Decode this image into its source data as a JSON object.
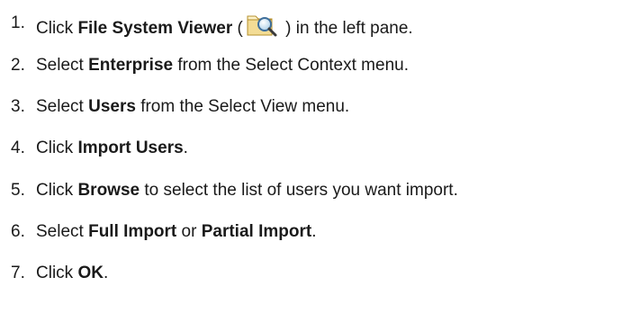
{
  "steps": [
    {
      "num": "1.",
      "pre": "Click ",
      "bold1": "File System Viewer",
      "mid": " (",
      "icon": "folder-magnifier-icon",
      "post": " ) in the left pane."
    },
    {
      "num": "2.",
      "pre": "Select ",
      "bold1": "Enterprise",
      "post": " from the Select Context menu."
    },
    {
      "num": "3.",
      "pre": "Select ",
      "bold1": "Users",
      "post": " from the Select View menu."
    },
    {
      "num": "4.",
      "pre": "Click ",
      "bold1": "Import Users",
      "post": "."
    },
    {
      "num": "5.",
      "pre": "Click ",
      "bold1": "Browse",
      "post": " to select the list of users you want import."
    },
    {
      "num": "6.",
      "pre": "Select ",
      "bold1": "Full Import",
      "mid": " or ",
      "bold2": "Partial Import",
      "post": "."
    },
    {
      "num": "7.",
      "pre": "Click ",
      "bold1": "OK",
      "post": "."
    }
  ]
}
